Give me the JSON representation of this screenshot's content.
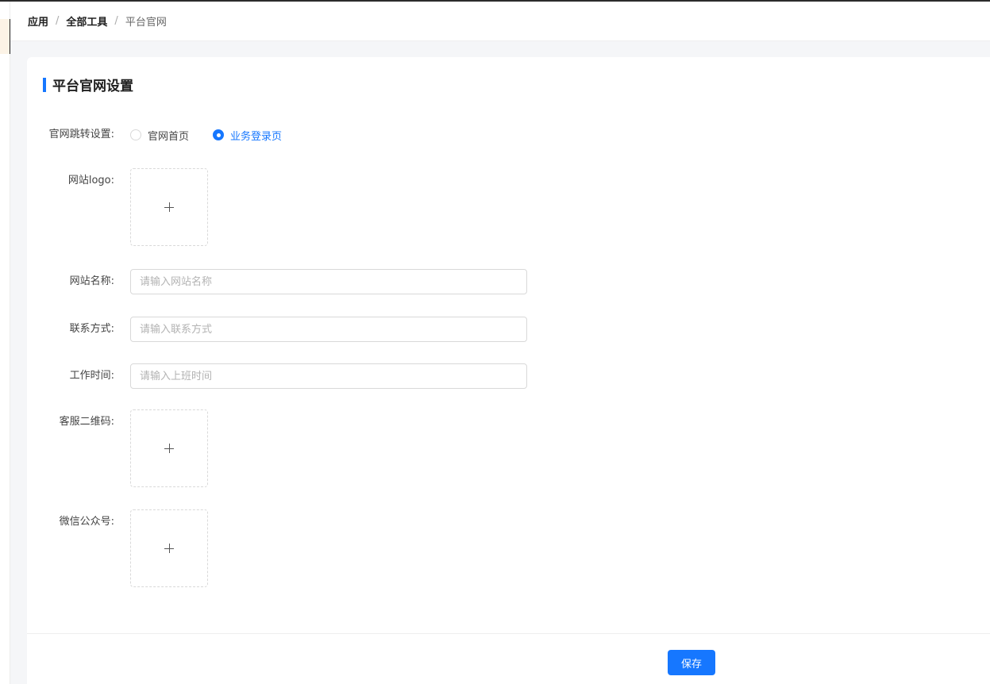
{
  "breadcrumb": {
    "items": [
      "应用",
      "全部工具",
      "平台官网"
    ],
    "separator": "/"
  },
  "card": {
    "title": "平台官网设置"
  },
  "form": {
    "redirect": {
      "label": "官网跳转设置:",
      "options": [
        "官网首页",
        "业务登录页"
      ],
      "selected": "业务登录页"
    },
    "logo": {
      "label": "网站logo:"
    },
    "site_name": {
      "label": "网站名称:",
      "placeholder": "请输入网站名称",
      "value": ""
    },
    "contact": {
      "label": "联系方式:",
      "placeholder": "请输入联系方式",
      "value": ""
    },
    "work_time": {
      "label": "工作时间:",
      "placeholder": "请输入上班时间",
      "value": ""
    },
    "qrcode": {
      "label": "客服二维码:"
    },
    "wechat": {
      "label": "微信公众号:"
    }
  },
  "footer": {
    "save_label": "保存"
  },
  "colors": {
    "primary": "#1677ff",
    "page_background": "#f5f6f8"
  },
  "icons": {
    "upload": "plus-icon"
  }
}
